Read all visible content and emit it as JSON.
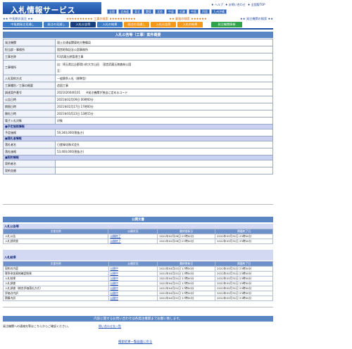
{
  "header": {
    "logo_text": "入札情報サービス",
    "top_links": [
      "♦ ヘルプ",
      "♦ お問い合わせ",
      "♦ 全国版TOP"
    ],
    "regions": [
      "全国",
      "北海道",
      "東北",
      "関東",
      "北陸",
      "中部",
      "近畿",
      "中国",
      "四国",
      "九州沖縄"
    ],
    "search_links": {
      "left": "★★ 中長期の発注 ★★",
      "mid1": "★★★★★★★★★★ 工事の検索 ★★★★★★★★★★",
      "mid2": "★★ 業務の検索 ★★★★★★",
      "right": "★★ 発注機関の検索 ★★"
    },
    "tabs": [
      {
        "label": "中長期発注見通し",
        "style": "blue"
      },
      {
        "label": "発注の見通し",
        "style": "blue"
      },
      {
        "label": "入札公告等",
        "style": "dark"
      },
      {
        "label": "入札の結果",
        "style": "blue"
      },
      {
        "label": "発注の見通し",
        "style": "orange"
      },
      {
        "label": "入札公告等",
        "style": "orange"
      },
      {
        "label": "入札の結果",
        "style": "orange"
      },
      {
        "label": "発注機関情報",
        "style": "green"
      }
    ]
  },
  "detail": {
    "title": "入札公告等（工事）案件概要",
    "rows": [
      {
        "label": "発注機関",
        "value": "国土交通省関東地方整備局"
      },
      {
        "label": "担当部・事務所",
        "value": "国営昭和記念公園事務所"
      },
      {
        "label": "工事名称",
        "value": "R3武蔵丘陵管理工事"
      },
      {
        "label": "工事場所",
        "value": "自：埼玉県比企郡滑川町大字山田 　国営武蔵丘陵森林公園\n至："
      },
      {
        "label": "入札契約方式",
        "value": "一般競争入札（標準型）"
      },
      {
        "label": "工事種別／工事の概要",
        "value": "造園工事"
      },
      {
        "label": "調達案件番号",
        "value": "2021020040101　　※発注機関が独自に定めるコード"
      },
      {
        "label": "公告日時",
        "value": "2021年02月09日 00時00分"
      },
      {
        "label": "期限日時",
        "value": "2021年02月17日 17時00分"
      },
      {
        "label": "開札日時",
        "value": "2021年03月23日 13時15分"
      },
      {
        "label": "電子入札対象",
        "value": "対象"
      },
      {
        "section": "■予定価格情報"
      },
      {
        "label": "予定価格",
        "value": "59,340,000(税抜き)"
      },
      {
        "section": "■落札者情報"
      },
      {
        "label": "落札者名",
        "value": "日産緑化株式会社"
      },
      {
        "label": "落札価格",
        "value": "53,400,000(税抜き)"
      },
      {
        "section": "■契約情報"
      },
      {
        "label": "契約者名",
        "value": ""
      },
      {
        "label": "契約金額",
        "value": ""
      }
    ]
  },
  "documents": {
    "title": "公開文書",
    "announcement": {
      "heading": "入札公告等",
      "columns": [
        "文書名称",
        "公開状況",
        "最終更新日",
        "掲載終了日"
      ],
      "rows": [
        [
          "入札公告",
          "公開終了",
          "2021年02月09日 07時00分",
          "2022年03月31日 23時00分"
        ],
        [
          "入札説明書",
          "公開終了",
          "2021年02月09日 07時00分",
          "2022年03月31日 23時00分"
        ]
      ]
    },
    "results": {
      "heading": "入札結果",
      "columns": [
        "文書名称",
        "公開状況",
        "最終更新日",
        "掲載終了日"
      ],
      "rows": [
        [
          "契約の内容",
          "公開中",
          "2021年04月01日 17時00分",
          "2022年03月31日 23時00分"
        ],
        [
          "競争参加資格確認結果",
          "公開中",
          "2021年04月01日 17時00分",
          "2022年03月31日 23時00分"
        ],
        [
          "入札結果",
          "公開中",
          "2021年04月01日 17時00分",
          "2022年03月31日 23時00分"
        ],
        [
          "入札調書",
          "公開中",
          "2021年04月01日 17時00分",
          "2022年03月31日 23時00分"
        ],
        [
          "入札調書（総合評価落札方式）",
          "公開中",
          "2021年04月01日 17時00分",
          "2022年03月31日 23時00分"
        ],
        [
          "評価点内訳",
          "公開中",
          "2021年04月01日 17時00分",
          "2022年03月31日 23時00分"
        ],
        [
          "積算内訳",
          "公開中",
          "2021年04月01日 17時00分",
          "2022年03月31日 23時00分"
        ]
      ]
    }
  },
  "contact": {
    "title": "内容に関するお問い合わせは各発注機関までお願い致します。",
    "text": "発注機関への連絡先等はこちらからご確認ください。",
    "link": "問い合わせ先一覧"
  },
  "back_link": "検索結果一覧画面に戻る",
  "colors": {
    "brand_blue": "#1e4fa0",
    "header_bar": "#5b86c4",
    "section_bg": "#c9d0f1",
    "orange_tab": "#f39a1c",
    "green_tab": "#2ea34a"
  }
}
